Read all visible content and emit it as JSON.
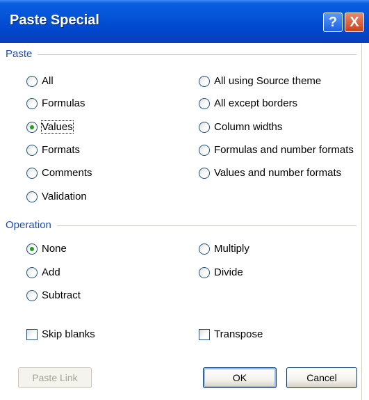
{
  "window": {
    "title": "Paste Special",
    "help_label": "?",
    "close_label": "X"
  },
  "paste": {
    "label": "Paste",
    "options_left": [
      "All",
      "Formulas",
      "Values",
      "Formats",
      "Comments",
      "Validation"
    ],
    "options_right": [
      "All using Source theme",
      "All except borders",
      "Column widths",
      "Formulas and number formats",
      "Values and number formats"
    ],
    "selected": "Values"
  },
  "operation": {
    "label": "Operation",
    "options_left": [
      "None",
      "Add",
      "Subtract"
    ],
    "options_right": [
      "Multiply",
      "Divide"
    ],
    "selected": "None"
  },
  "checkboxes": {
    "skip_blanks": "Skip blanks",
    "transpose": "Transpose",
    "skip_blanks_checked": false,
    "transpose_checked": false
  },
  "buttons": {
    "paste_link": "Paste Link",
    "ok": "OK",
    "cancel": "Cancel"
  },
  "colors": {
    "title_bar": "#0453d8",
    "group_label": "#1b4bc4",
    "radio_selected": "#21a121"
  }
}
